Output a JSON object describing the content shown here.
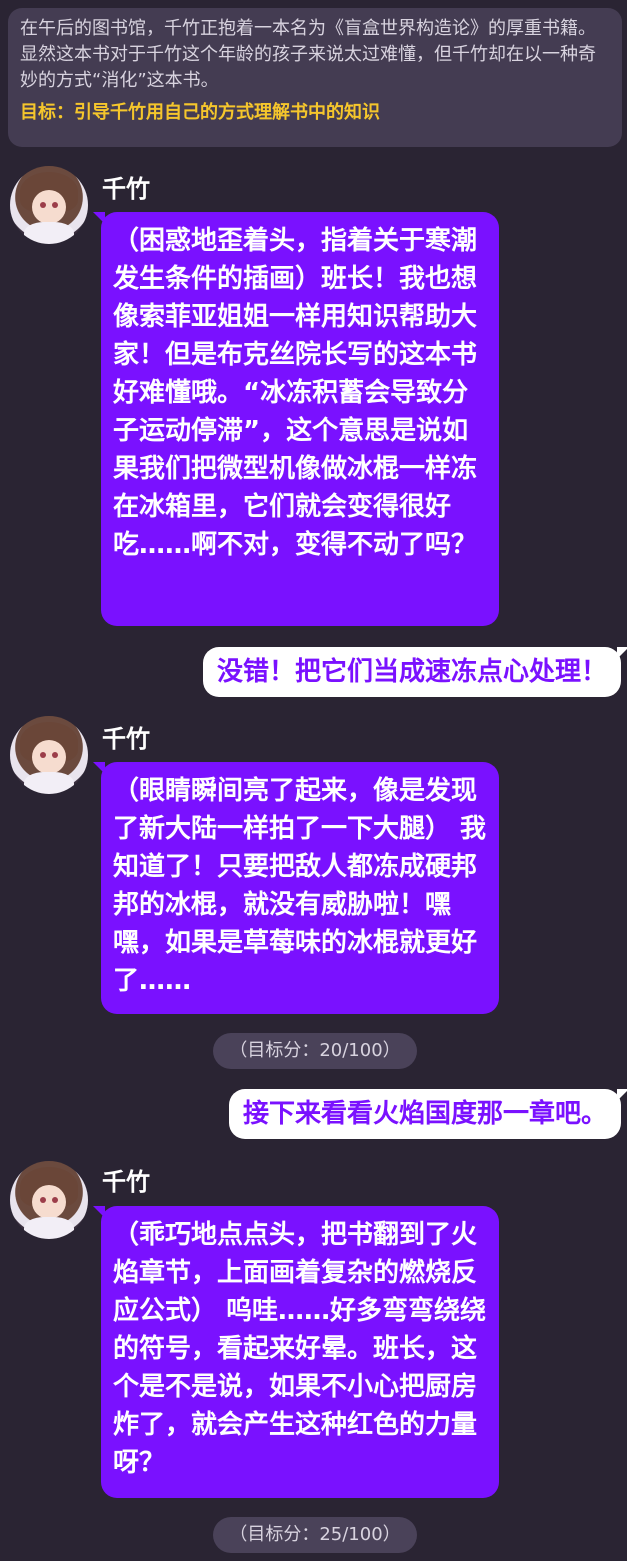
{
  "scene": {
    "description": "在午后的图书馆，千竹正抱着一本名为《盲盒世界构造论》的厚重书籍。显然这本书对于千竹这个年龄的孩子来说太过难懂，但千竹却在以一种奇妙的方式“消化”这本书。",
    "goal": "目标：引导千竹用自己的方式理解书中的知识"
  },
  "messages": [
    {
      "sender": "千竹",
      "text": "（困惑地歪着头，指着关于寒潮发生条件的插画）班长！我也想像索菲亚姐姐一样用知识帮助大家！但是布克丝院长写的这本书好难懂哦。“冰冻积蓄会导致分子运动停滞”，这个意思是说如果我们把微型机像做冰棍一样冻在冰箱里，它们就会变得很好吃……啊不对，变得不动了吗？"
    },
    {
      "sender": "user",
      "text": "没错！把它们当成速冻点心处理！"
    },
    {
      "sender": "千竹",
      "text": "（眼睛瞬间亮了起来，像是发现了新大陆一样拍了一下大腿） 我知道了！只要把敌人都冻成硬邦邦的冰棍，就没有威胁啦！嘿嘿，如果是草莓味的冰棍就更好了……"
    },
    {
      "type": "score",
      "text": "（目标分：20/100）"
    },
    {
      "sender": "user",
      "text": "接下来看看火焰国度那一章吧。"
    },
    {
      "sender": "千竹",
      "text": "（乖巧地点点头，把书翻到了火焰章节，上面画着复杂的燃烧反应公式） 呜哇……好多弯弯绕绕的符号，看起来好晕。班长，这个是不是说，如果不小心把厨房炸了，就会产生这种红色的力量呀？"
    },
    {
      "type": "score",
      "text": "（目标分：25/100）"
    }
  ],
  "colors": {
    "background": "#2a2433",
    "incoming_bubble": "#7a11ff",
    "outgoing_bubble": "#ffffff",
    "goal_text": "#f5c62c"
  }
}
